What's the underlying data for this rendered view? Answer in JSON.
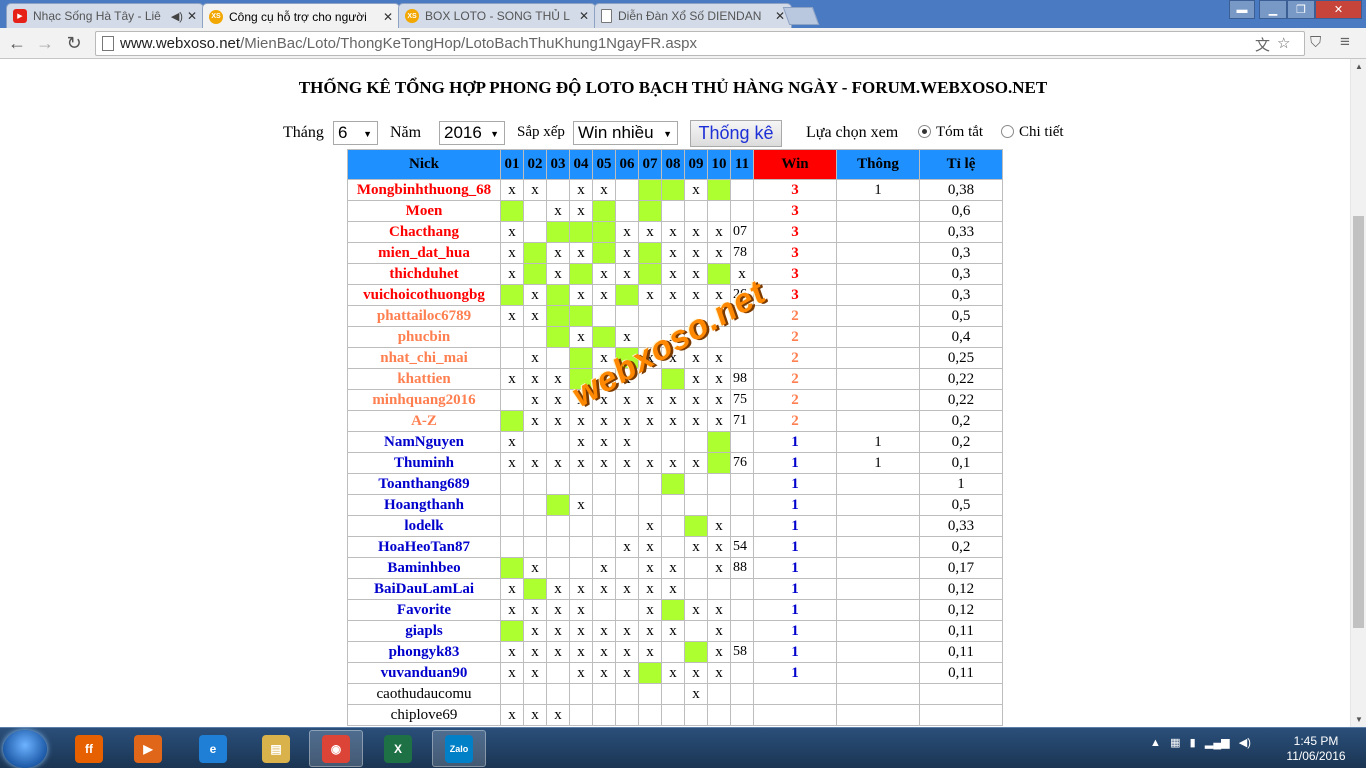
{
  "tabs": [
    {
      "title": "Nhạc Sống Hà Tây - Liê",
      "icon": "youtube-icon",
      "active": false,
      "audio": true
    },
    {
      "title": "Công cụ hỗ trợ cho người",
      "icon": "webxoso-icon",
      "active": true,
      "audio": false
    },
    {
      "title": "BOX LOTO - SONG THỦ L",
      "icon": "webxoso-icon",
      "active": false,
      "audio": false
    },
    {
      "title": "Diễn Đàn Xổ Số DIENDAN",
      "icon": "page-icon",
      "active": false,
      "audio": false
    }
  ],
  "address": {
    "host": "www.webxoso.net",
    "path": "/MienBac/Loto/ThongKeTongHop/LotoBachThuKhung1NgayFR.aspx"
  },
  "page_title": "THỐNG KÊ TỔNG HỢP PHONG ĐỘ LOTO BẠCH THỦ HÀNG NGÀY - FORUM.WEBXOSO.NET",
  "filters": {
    "month_label": "Tháng",
    "month_value": "6",
    "year_label": "Năm",
    "year_value": "2016",
    "sort_label": "Sắp xếp",
    "sort_value": "Win nhiều",
    "submit_label": "Thống kê",
    "view_label": "Lựa chọn xem",
    "view_options": [
      {
        "label": "Tóm tắt",
        "selected": true
      },
      {
        "label": "Chi tiết",
        "selected": false
      }
    ]
  },
  "table": {
    "headers": [
      "Nick",
      "01",
      "02",
      "03",
      "04",
      "05",
      "06",
      "07",
      "08",
      "09",
      "10",
      "11",
      "Win",
      "Thông",
      "Tỉ lệ"
    ],
    "colors": {
      "header": "#1e90ff",
      "win_header": "#ff0000",
      "hit": "#adff2f",
      "tier3": "#ff0000",
      "tier2": "#ff7f50",
      "tier1": "#0000cd"
    },
    "rows": [
      {
        "nick": "Mongbinhthuong_68",
        "tier": 3,
        "cells": [
          "x",
          "x",
          "",
          "x",
          "x",
          "",
          "G",
          "G",
          "x",
          "G",
          ""
        ],
        "win": "3",
        "thong": "1",
        "ratio": "0,38"
      },
      {
        "nick": "Moen",
        "tier": 3,
        "cells": [
          "G",
          "",
          "x",
          "x",
          "G",
          "",
          "G",
          "",
          "",
          "",
          ""
        ],
        "win": "3",
        "thong": "",
        "ratio": "0,6"
      },
      {
        "nick": "Chacthang",
        "tier": 3,
        "cells": [
          "x",
          "",
          "G",
          "G",
          "G",
          "x",
          "x",
          "x",
          "x",
          "x",
          "07"
        ],
        "win": "3",
        "thong": "",
        "ratio": "0,33"
      },
      {
        "nick": "mien_dat_hua",
        "tier": 3,
        "cells": [
          "x",
          "G",
          "x",
          "x",
          "G",
          "x",
          "G",
          "x",
          "x",
          "x",
          "78"
        ],
        "win": "3",
        "thong": "",
        "ratio": "0,3"
      },
      {
        "nick": "thichduhet",
        "tier": 3,
        "cells": [
          "x",
          "G",
          "x",
          "G",
          "x",
          "x",
          "G",
          "x",
          "x",
          "G",
          "x"
        ],
        "win": "3",
        "thong": "",
        "ratio": "0,3"
      },
      {
        "nick": "vuichoicothuongbg",
        "tier": 3,
        "cells": [
          "G",
          "x",
          "G",
          "x",
          "x",
          "G",
          "x",
          "x",
          "x",
          "x",
          "26"
        ],
        "win": "3",
        "thong": "",
        "ratio": "0,3"
      },
      {
        "nick": "phattailoc6789",
        "tier": 2,
        "cells": [
          "x",
          "x",
          "G",
          "G",
          "",
          "",
          "",
          "",
          "",
          "",
          ""
        ],
        "win": "2",
        "thong": "",
        "ratio": "0,5"
      },
      {
        "nick": "phucbin",
        "tier": 2,
        "cells": [
          "",
          "",
          "G",
          "x",
          "G",
          "x",
          "",
          "x",
          "",
          "",
          ""
        ],
        "win": "2",
        "thong": "",
        "ratio": "0,4"
      },
      {
        "nick": "nhat_chi_mai",
        "tier": 2,
        "cells": [
          "",
          "x",
          "",
          "G",
          "x",
          "G",
          "x",
          "x",
          "x",
          "x",
          ""
        ],
        "win": "2",
        "thong": "",
        "ratio": "0,25"
      },
      {
        "nick": "khattien",
        "tier": 2,
        "cells": [
          "x",
          "x",
          "x",
          "G",
          "x",
          "x",
          "",
          "G",
          "x",
          "x",
          "98"
        ],
        "win": "2",
        "thong": "",
        "ratio": "0,22"
      },
      {
        "nick": "minhquang2016",
        "tier": 2,
        "cells": [
          "",
          "x",
          "x",
          "x",
          "x",
          "x",
          "x",
          "x",
          "x",
          "x",
          "75"
        ],
        "win": "2",
        "thong": "",
        "ratio": "0,22"
      },
      {
        "nick": "A-Z",
        "tier": 2,
        "cells": [
          "G",
          "x",
          "x",
          "x",
          "x",
          "x",
          "x",
          "x",
          "x",
          "x",
          "71"
        ],
        "win": "2",
        "thong": "",
        "ratio": "0,2"
      },
      {
        "nick": "NamNguyen",
        "tier": 1,
        "cells": [
          "x",
          "",
          "",
          "x",
          "x",
          "x",
          "",
          "",
          "",
          "G",
          ""
        ],
        "win": "1",
        "thong": "1",
        "ratio": "0,2"
      },
      {
        "nick": "Thuminh",
        "tier": 1,
        "cells": [
          "x",
          "x",
          "x",
          "x",
          "x",
          "x",
          "x",
          "x",
          "x",
          "G",
          "76"
        ],
        "win": "1",
        "thong": "1",
        "ratio": "0,1"
      },
      {
        "nick": "Toanthang689",
        "tier": 1,
        "cells": [
          "",
          "",
          "",
          "",
          "",
          "",
          "",
          "G",
          "",
          "",
          ""
        ],
        "win": "1",
        "thong": "",
        "ratio": "1"
      },
      {
        "nick": "Hoangthanh",
        "tier": 1,
        "cells": [
          "",
          "",
          "G",
          "x",
          "",
          "",
          "",
          "",
          "",
          "",
          ""
        ],
        "win": "1",
        "thong": "",
        "ratio": "0,5"
      },
      {
        "nick": "lodelk",
        "tier": 1,
        "cells": [
          "",
          "",
          "",
          "",
          "",
          "",
          "x",
          "",
          "G",
          "x",
          ""
        ],
        "win": "1",
        "thong": "",
        "ratio": "0,33"
      },
      {
        "nick": "HoaHeoTan87",
        "tier": 1,
        "cells": [
          "",
          "",
          "",
          "",
          "",
          "x",
          "x",
          "",
          "x",
          "x",
          "54"
        ],
        "win": "1",
        "thong": "",
        "ratio": "0,2"
      },
      {
        "nick": "Baminhbeo",
        "tier": 1,
        "cells": [
          "G",
          "x",
          "",
          "",
          "x",
          "",
          "x",
          "x",
          "",
          "x",
          "88"
        ],
        "win": "1",
        "thong": "",
        "ratio": "0,17"
      },
      {
        "nick": "BaiDauLamLai",
        "tier": 1,
        "cells": [
          "x",
          "G",
          "x",
          "x",
          "x",
          "x",
          "x",
          "x",
          "",
          "",
          ""
        ],
        "win": "1",
        "thong": "",
        "ratio": "0,12"
      },
      {
        "nick": "Favorite",
        "tier": 1,
        "cells": [
          "x",
          "x",
          "x",
          "x",
          "",
          "",
          "x",
          "G",
          "x",
          "x",
          ""
        ],
        "win": "1",
        "thong": "",
        "ratio": "0,12"
      },
      {
        "nick": "giapls",
        "tier": 1,
        "cells": [
          "G",
          "x",
          "x",
          "x",
          "x",
          "x",
          "x",
          "x",
          "",
          "x",
          ""
        ],
        "win": "1",
        "thong": "",
        "ratio": "0,11"
      },
      {
        "nick": "phongyk83",
        "tier": 1,
        "cells": [
          "x",
          "x",
          "x",
          "x",
          "x",
          "x",
          "x",
          "",
          "G",
          "x",
          "58"
        ],
        "win": "1",
        "thong": "",
        "ratio": "0,11"
      },
      {
        "nick": "vuvanduan90",
        "tier": 1,
        "cells": [
          "x",
          "x",
          "",
          "x",
          "x",
          "x",
          "G",
          "x",
          "x",
          "x",
          ""
        ],
        "win": "1",
        "thong": "",
        "ratio": "0,11"
      },
      {
        "nick": "caothudaucomu",
        "tier": 0,
        "cells": [
          "",
          "",
          "",
          "",
          "",
          "",
          "",
          "",
          "x",
          "",
          ""
        ],
        "win": "",
        "thong": "",
        "ratio": ""
      },
      {
        "nick": "chiplove69",
        "tier": 0,
        "cells": [
          "x",
          "x",
          "x",
          "",
          "",
          "",
          "",
          "",
          "",
          "",
          ""
        ],
        "win": "",
        "thong": "",
        "ratio": ""
      }
    ]
  },
  "watermark": "webxoso.net",
  "taskbar": {
    "apps": [
      {
        "name": "firefox-icon",
        "color": "#e66000",
        "glyph": "ff"
      },
      {
        "name": "media-player-icon",
        "color": "#e0661a",
        "glyph": "▶"
      },
      {
        "name": "ie-icon",
        "color": "#1f7fd6",
        "glyph": "e"
      },
      {
        "name": "explorer-icon",
        "color": "#d9b24c",
        "glyph": "▤"
      },
      {
        "name": "chrome-icon",
        "color": "#db4437",
        "glyph": "◉",
        "active": true
      },
      {
        "name": "excel-icon",
        "color": "#1e7145",
        "glyph": "X"
      },
      {
        "name": "zalo-icon",
        "color": "#0180c7",
        "glyph": "Zalo",
        "active": true
      }
    ],
    "time": "1:45 PM",
    "date": "11/06/2016"
  }
}
